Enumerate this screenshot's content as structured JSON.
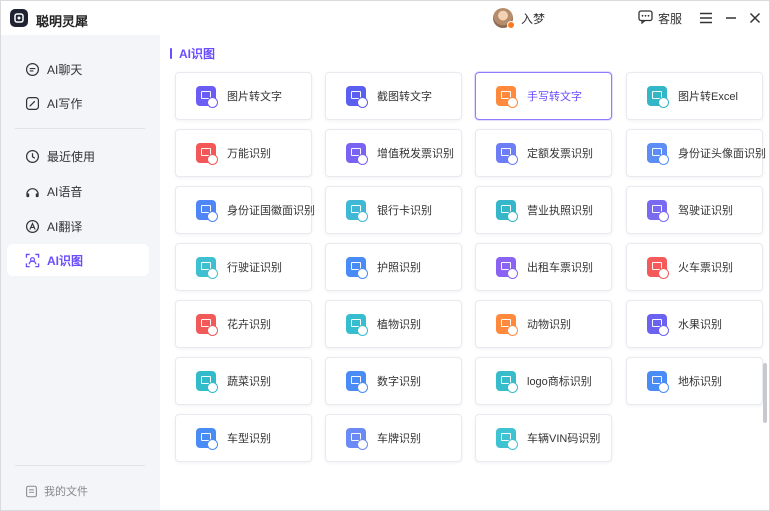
{
  "app": {
    "name": "聪明灵犀"
  },
  "user": {
    "name": "入梦"
  },
  "titlebar": {
    "service_label": "客服"
  },
  "sidebar": {
    "items": [
      {
        "label": "AI聊天",
        "icon": "chat-icon",
        "active": false
      },
      {
        "label": "AI写作",
        "icon": "write-icon",
        "active": false
      },
      {
        "label": "最近使用",
        "icon": "clock-icon",
        "active": false
      },
      {
        "label": "AI语音",
        "icon": "voice-icon",
        "active": false
      },
      {
        "label": "AI翻译",
        "icon": "translate-icon",
        "active": false
      },
      {
        "label": "AI识图",
        "icon": "scan-icon",
        "active": true
      }
    ],
    "my_files": "我的文件"
  },
  "main": {
    "section_title": "AI识图",
    "cards": [
      {
        "label": "图片转文字",
        "icon": "image-to-text-icon",
        "color": "#6c5cf6"
      },
      {
        "label": "截图转文字",
        "icon": "screenshot-to-text-icon",
        "color": "#5a5ff0"
      },
      {
        "label": "手写转文字",
        "icon": "handwriting-to-text-icon",
        "color": "#ff8a3d",
        "selected": true
      },
      {
        "label": "图片转Excel",
        "icon": "image-to-excel-icon",
        "color": "#33b6c8"
      },
      {
        "label": "万能识别",
        "icon": "universal-recognition-icon",
        "color": "#f45757"
      },
      {
        "label": "增值税发票识别",
        "icon": "vat-invoice-icon",
        "color": "#7a62f3"
      },
      {
        "label": "定额发票识别",
        "icon": "fixed-invoice-icon",
        "color": "#6c7df5"
      },
      {
        "label": "身份证头像面识别",
        "icon": "id-card-front-icon",
        "color": "#5b8df5"
      },
      {
        "label": "身份证国徽面识别",
        "icon": "id-card-back-icon",
        "color": "#4f86f7"
      },
      {
        "label": "银行卡识别",
        "icon": "bank-card-icon",
        "color": "#3fb8d6"
      },
      {
        "label": "营业执照识别",
        "icon": "business-license-icon",
        "color": "#35b6c9"
      },
      {
        "label": "驾驶证识别",
        "icon": "driver-license-icon",
        "color": "#7a6af2"
      },
      {
        "label": "行驶证识别",
        "icon": "vehicle-license-icon",
        "color": "#3fc0d0"
      },
      {
        "label": "护照识别",
        "icon": "passport-icon",
        "color": "#4a8cf6"
      },
      {
        "label": "出租车票识别",
        "icon": "taxi-ticket-icon",
        "color": "#8a63f2"
      },
      {
        "label": "火车票识别",
        "icon": "train-ticket-icon",
        "color": "#f45a5a"
      },
      {
        "label": "花卉识别",
        "icon": "flower-icon",
        "color": "#f25a5a"
      },
      {
        "label": "植物识别",
        "icon": "plant-icon",
        "color": "#37bdd0"
      },
      {
        "label": "动物识别",
        "icon": "animal-icon",
        "color": "#ff8a3d"
      },
      {
        "label": "水果识别",
        "icon": "fruit-icon",
        "color": "#6c62f2"
      },
      {
        "label": "蔬菜识别",
        "icon": "vegetable-icon",
        "color": "#32bccb"
      },
      {
        "label": "数字识别",
        "icon": "number-icon",
        "color": "#4a8cf6"
      },
      {
        "label": "logo商标识别",
        "icon": "logo-trademark-icon",
        "color": "#36bccb"
      },
      {
        "label": "地标识别",
        "icon": "landmark-icon",
        "color": "#4a8cf6"
      },
      {
        "label": "车型识别",
        "icon": "car-model-icon",
        "color": "#4a8cf6"
      },
      {
        "label": "车牌识别",
        "icon": "license-plate-icon",
        "color": "#6a8af5"
      },
      {
        "label": "车辆VIN码识别",
        "icon": "vin-code-icon",
        "color": "#3fc3d2"
      }
    ]
  }
}
